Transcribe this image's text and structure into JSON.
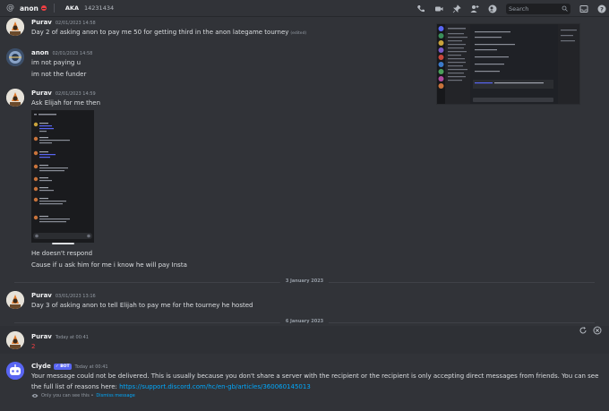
{
  "header": {
    "dm_name": "anon",
    "aka_label": "AKA",
    "aka_value": "14231434",
    "search_placeholder": "Search"
  },
  "messages": [
    {
      "author": "Purav",
      "timestamp": "02/01/2023 14:58",
      "lines": [
        "Day 2 of asking anon to pay me 50 for getting third in the anon lategame tourney"
      ],
      "edited": "(edited)"
    },
    {
      "author": "anon",
      "timestamp": "02/01/2023 14:58",
      "lines": [
        "im not paying u",
        "im not the funder"
      ]
    },
    {
      "author": "Purav",
      "timestamp": "02/01/2023 14:59",
      "lines": [
        "Ask Elijah for me then",
        "He doesn't respond",
        "Cause if u ask him for me i know he will pay Insta"
      ]
    },
    {
      "author": "Purav",
      "timestamp": "03/01/2023 13:16",
      "lines": [
        "Day 3 of asking anon to tell Elijah to pay me for the tourney he hosted"
      ]
    },
    {
      "author": "Purav",
      "timestamp": "Today at 00:41",
      "lines": [
        "2"
      ]
    },
    {
      "author": "Clyde",
      "badge": "BOT",
      "timestamp": "Today at 00:41",
      "lines": [
        "Your message could not be delivered. This is usually because you don't share a server with the recipient or the recipient is only accepting direct messages from friends. You can see",
        "the full list of reasons here: "
      ],
      "link": "https://support.discord.com/hc/en-gb/articles/360060145013",
      "only_you": "Only you can see this •",
      "dismiss": "Dismiss message"
    }
  ],
  "dividers": [
    "3 January 2023",
    "6 January 2023"
  ],
  "colors": {
    "background": "#313338",
    "link": "#00a8fc",
    "dnd": "#f23f43",
    "bot_badge": "#5865f2",
    "number_red": "#f23f43"
  }
}
